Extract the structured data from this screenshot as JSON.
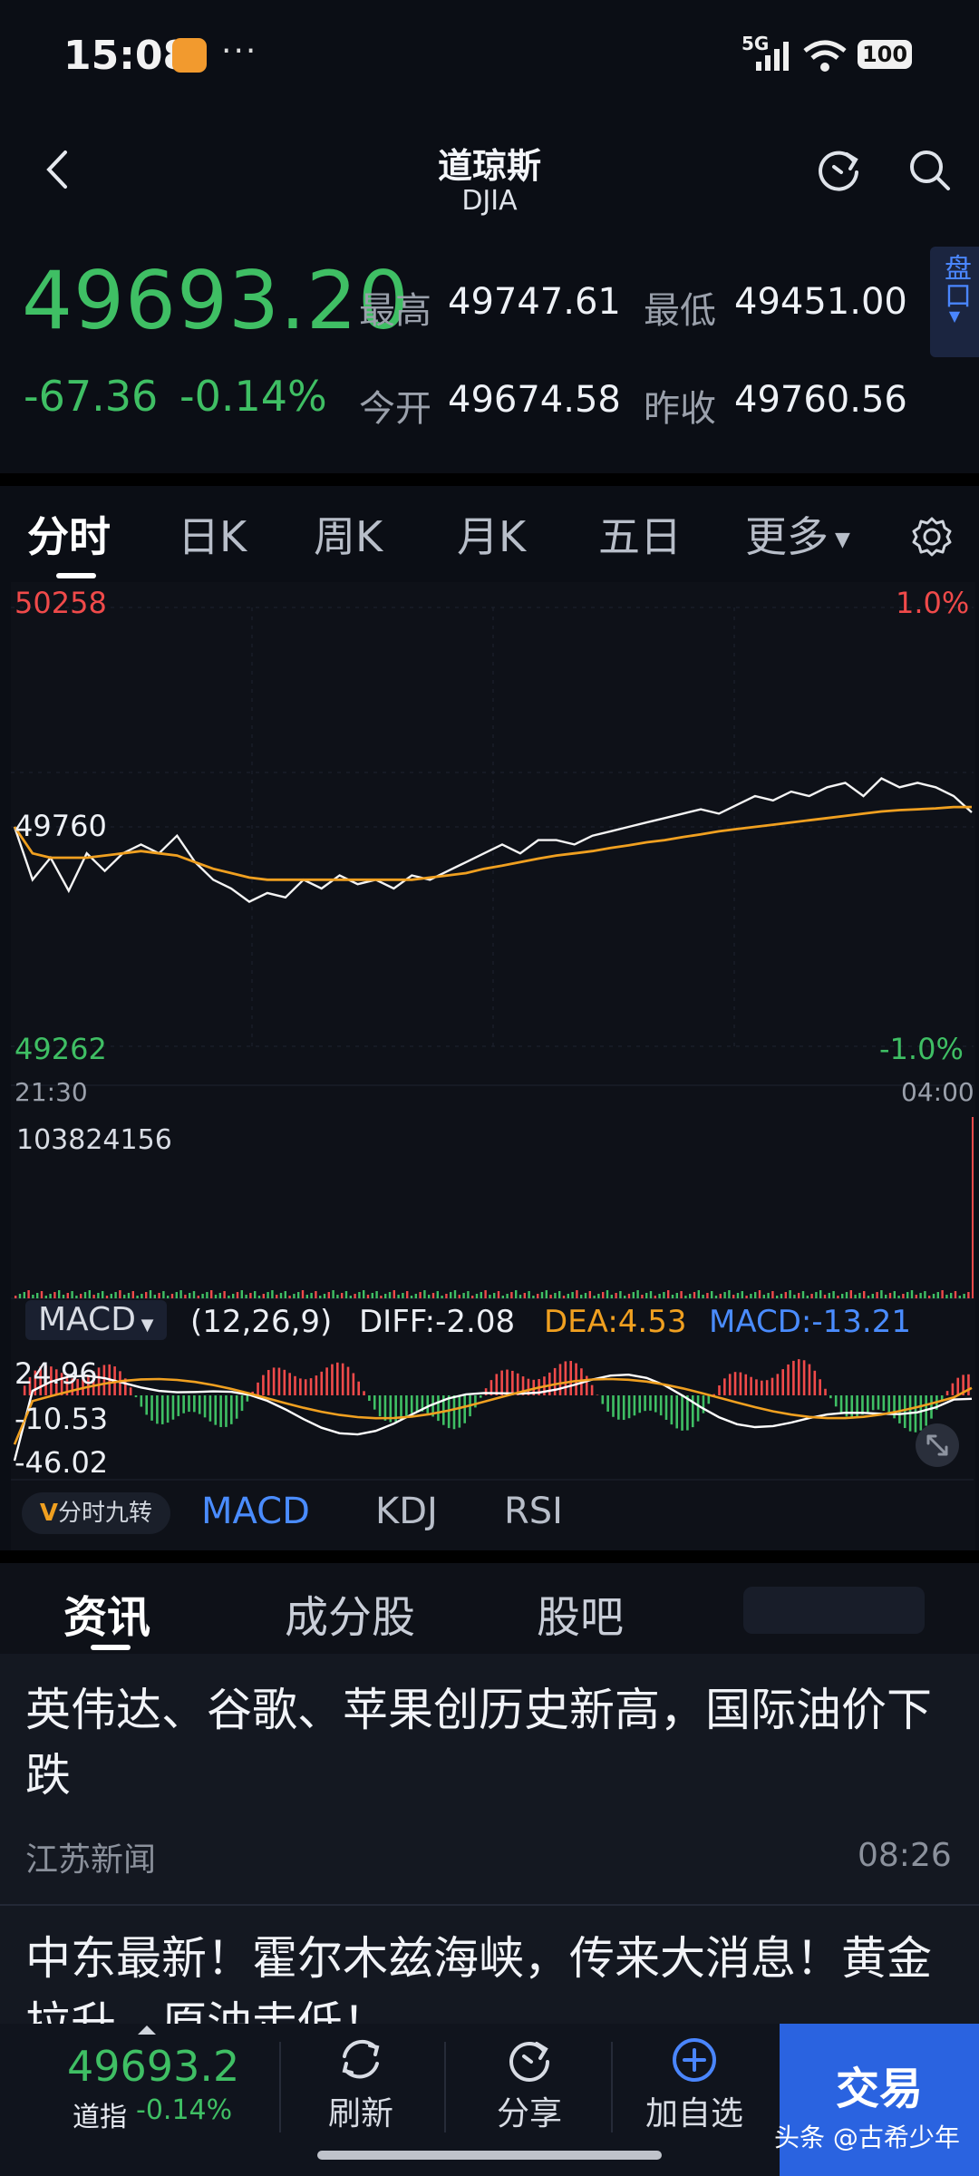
{
  "status_bar": {
    "time": "15:08",
    "network": "5G",
    "battery": "100",
    "more": "···"
  },
  "header": {
    "title": "道琼斯",
    "subtitle": "DJIA"
  },
  "quote": {
    "price": "49693.20",
    "change_abs": "-67.36",
    "change_pct": "-0.14%",
    "high_label": "最高",
    "high": "49747.61",
    "low_label": "最低",
    "low": "49451.00",
    "open_label": "今开",
    "open": "49674.58",
    "prev_close_label": "昨收",
    "prev_close": "49760.56",
    "pankou_label": "盘口"
  },
  "chart_tabs": [
    "分时",
    "日K",
    "周K",
    "月K",
    "五日",
    "更多"
  ],
  "chart": {
    "y_max_label": "50258",
    "y_mid_label": "49760",
    "y_min_label": "49262",
    "pct_max_label": "1.0%",
    "pct_min_label": "-1.0%",
    "x_start_label": "21:30",
    "x_end_label": "04:00",
    "volume_label": "103824156",
    "macd_selector": "MACD",
    "macd_params": "(12,26,9)",
    "diff_text": "DIFF:-2.08",
    "dea_text": "DEA:4.53",
    "macd_text": "MACD:-13.21",
    "macd_axis_top": "24.96",
    "macd_axis_mid": "-10.53",
    "macd_axis_bot": "-46.02"
  },
  "chart_data": {
    "type": "line",
    "title": "",
    "xlabel": "",
    "ylabel": "",
    "x_range": [
      "21:30",
      "04:00"
    ],
    "ylim": [
      49262,
      50258
    ],
    "prev_close": 49760,
    "series": [
      {
        "name": "",
        "values": [
          49760,
          49640,
          49690,
          49615,
          49700,
          49660,
          49700,
          49720,
          49700,
          49740,
          49680,
          49640,
          49620,
          49590,
          49610,
          49600,
          49640,
          49620,
          49650,
          49630,
          49640,
          49620,
          49650,
          49640,
          49660,
          49680,
          49700,
          49720,
          49700,
          49730,
          49730,
          49720,
          49740,
          49750,
          49760,
          49770,
          49780,
          49790,
          49800,
          49790,
          49810,
          49830,
          49820,
          49840,
          49830,
          49850,
          49860,
          49830,
          49870,
          49850,
          49860,
          49850,
          49830,
          49793
        ]
      },
      {
        "name": "",
        "values": [
          49760,
          49700,
          49690,
          49690,
          49690,
          49695,
          49700,
          49705,
          49700,
          49695,
          49680,
          49665,
          49655,
          49645,
          49640,
          49640,
          49640,
          49640,
          49640,
          49640,
          49640,
          49640,
          49640,
          49645,
          49650,
          49655,
          49665,
          49672,
          49680,
          49688,
          49695,
          49700,
          49705,
          49712,
          49718,
          49725,
          49730,
          49737,
          49743,
          49750,
          49755,
          49760,
          49765,
          49770,
          49775,
          49780,
          49785,
          49790,
          49795,
          49798,
          49800,
          49802,
          49805,
          49805
        ]
      }
    ],
    "macd_indicator": {
      "diff": -2.08,
      "dea": 4.53,
      "macd": -13.21,
      "ylim": [
        -46.02,
        24.96
      ]
    },
    "grid": true
  },
  "indicator_tabs": {
    "v_label": "分时九转",
    "tabs": [
      "MACD",
      "KDJ",
      "RSI"
    ]
  },
  "news_tabs": [
    "资讯",
    "成分股",
    "股吧"
  ],
  "news": [
    {
      "title": "英伟达、谷歌、苹果创历史新高，国际油价下跌",
      "source": "江苏新闻",
      "time": "08:26"
    },
    {
      "title": "中东最新！霍尔木兹海峡，传来大消息！黄金拉升，原油走低！"
    }
  ],
  "bottom_bar": {
    "price": "49693.2",
    "name": "道指",
    "change_pct": "-0.14%",
    "refresh_label": "刷新",
    "share_label": "分享",
    "add_label": "加自选",
    "trade_label": "交易",
    "watermark": "头条 @古希少年"
  },
  "colors": {
    "up": "#f04a4a",
    "down": "#3fbf64",
    "accent": "#2a63e0",
    "avg_line": "#f0a020"
  }
}
